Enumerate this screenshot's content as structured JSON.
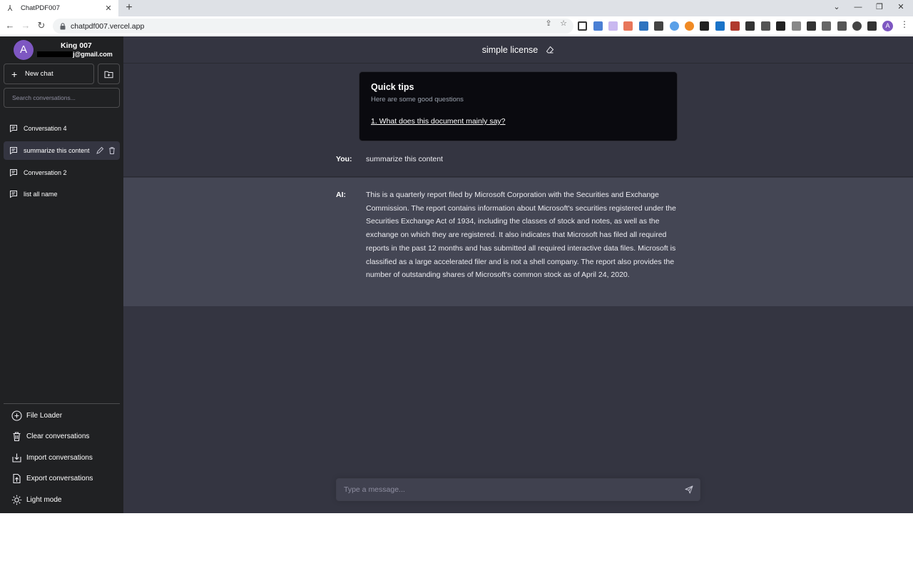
{
  "browser": {
    "tab_title": "ChatPDF007",
    "url": "chatpdf007.vercel.app",
    "profile_initial": "A"
  },
  "user": {
    "avatar_initial": "A",
    "name": "King 007",
    "email_visible": "j@gmail.com"
  },
  "sidebar": {
    "new_chat_label": "New chat",
    "search_placeholder": "Search conversations...",
    "conversations": [
      {
        "label": "Conversation 4"
      },
      {
        "label": "summarize this content"
      },
      {
        "label": "Conversation 2"
      },
      {
        "label": "list all name"
      }
    ],
    "bottom_items": [
      {
        "label": "File Loader",
        "icon": "plus-circle-icon"
      },
      {
        "label": "Clear conversations",
        "icon": "trash-icon"
      },
      {
        "label": "Import conversations",
        "icon": "import-icon"
      },
      {
        "label": "Export conversations",
        "icon": "export-icon"
      },
      {
        "label": "Light mode",
        "icon": "sun-icon"
      }
    ]
  },
  "main": {
    "title": "simple license",
    "quick_tips": {
      "heading": "Quick tips",
      "subheading": "Here are some good questions",
      "question": "1. What does this document mainly say?"
    },
    "messages": [
      {
        "speaker": "You:",
        "text": "summarize this content"
      },
      {
        "speaker": "AI:",
        "text": "This is a quarterly report filed by Microsoft Corporation with the Securities and Exchange Commission. The report contains information about Microsoft's securities registered under the Securities Exchange Act of 1934, including the classes of stock and notes, as well as the exchange on which they are registered. It also indicates that Microsoft has filed all required reports in the past 12 months and has submitted all required interactive data files. Microsoft is classified as a large accelerated filer and is not a shell company. The report also provides the number of outstanding shares of Microsoft's common stock as of April 24, 2020."
      }
    ],
    "composer_placeholder": "Type a message..."
  },
  "colors": {
    "sidebar_bg": "#202123",
    "main_bg": "#343541",
    "ai_msg_bg": "#444654",
    "avatar": "#7e57c2"
  }
}
